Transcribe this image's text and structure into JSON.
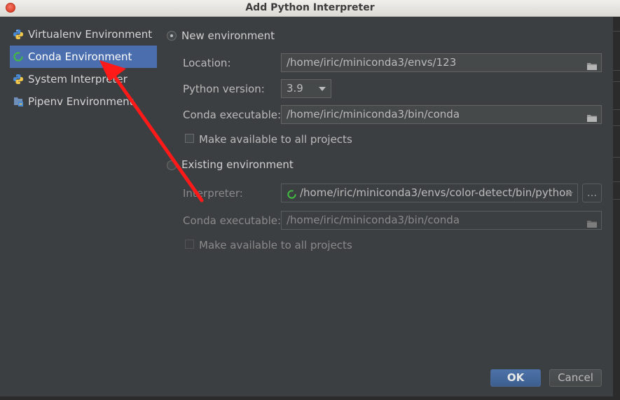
{
  "window": {
    "title": "Add Python Interpreter"
  },
  "sidebar": {
    "items": [
      {
        "label": "Virtualenv Environment",
        "icon": "python-icon",
        "selected": false
      },
      {
        "label": "Conda Environment",
        "icon": "conda-icon",
        "selected": true
      },
      {
        "label": "System Interpreter",
        "icon": "python-icon",
        "selected": false
      },
      {
        "label": "Pipenv Environment",
        "icon": "pipenv-icon",
        "selected": false
      }
    ]
  },
  "new_env": {
    "radio_label": "New environment",
    "selected": true,
    "location_label": "Location:",
    "location_value": "/home/iric/miniconda3/envs/123",
    "python_version_label": "Python version:",
    "python_version_value": "3.9",
    "conda_exec_label": "Conda executable:",
    "conda_exec_value": "/home/iric/miniconda3/bin/conda",
    "make_available_label": "Make available to all projects"
  },
  "existing_env": {
    "radio_label": "Existing environment",
    "selected": false,
    "interpreter_label": "Interpreter:",
    "interpreter_value": "/home/iric/miniconda3/envs/color-detect/bin/python",
    "browse_label": "...",
    "conda_exec_label": "Conda executable:",
    "conda_exec_value": "/home/iric/miniconda3/bin/conda",
    "make_available_label": "Make available to all projects"
  },
  "buttons": {
    "ok": "OK",
    "cancel": "Cancel"
  },
  "colors": {
    "selection": "#4b6eaf",
    "background": "#3c3f41",
    "annotation_arrow": "#ff1a1a",
    "conda_green": "#3db03d"
  }
}
